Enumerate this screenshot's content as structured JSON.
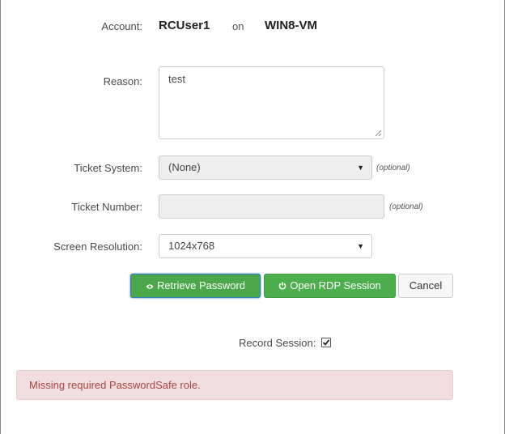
{
  "account": {
    "label": "Account:",
    "user": "RCUser1",
    "on": "on",
    "host": "WIN8-VM"
  },
  "reason": {
    "label": "Reason:",
    "value": "test"
  },
  "ticket_system": {
    "label": "Ticket System:",
    "selected": "(None)",
    "hint": "(optional)"
  },
  "ticket_number": {
    "label": "Ticket Number:",
    "value": "",
    "hint": "(optional)"
  },
  "screen_resolution": {
    "label": "Screen Resolution:",
    "selected": "1024x768"
  },
  "buttons": {
    "retrieve": "Retrieve Password",
    "rdp": "Open RDP Session",
    "cancel": "Cancel"
  },
  "record_session": {
    "label": "Record Session:",
    "checked": true
  },
  "alert": {
    "message": "Missing required PasswordSafe role."
  },
  "colors": {
    "success": "#4cae4c",
    "alert_bg": "#f2dede",
    "alert_text": "#a94442"
  }
}
